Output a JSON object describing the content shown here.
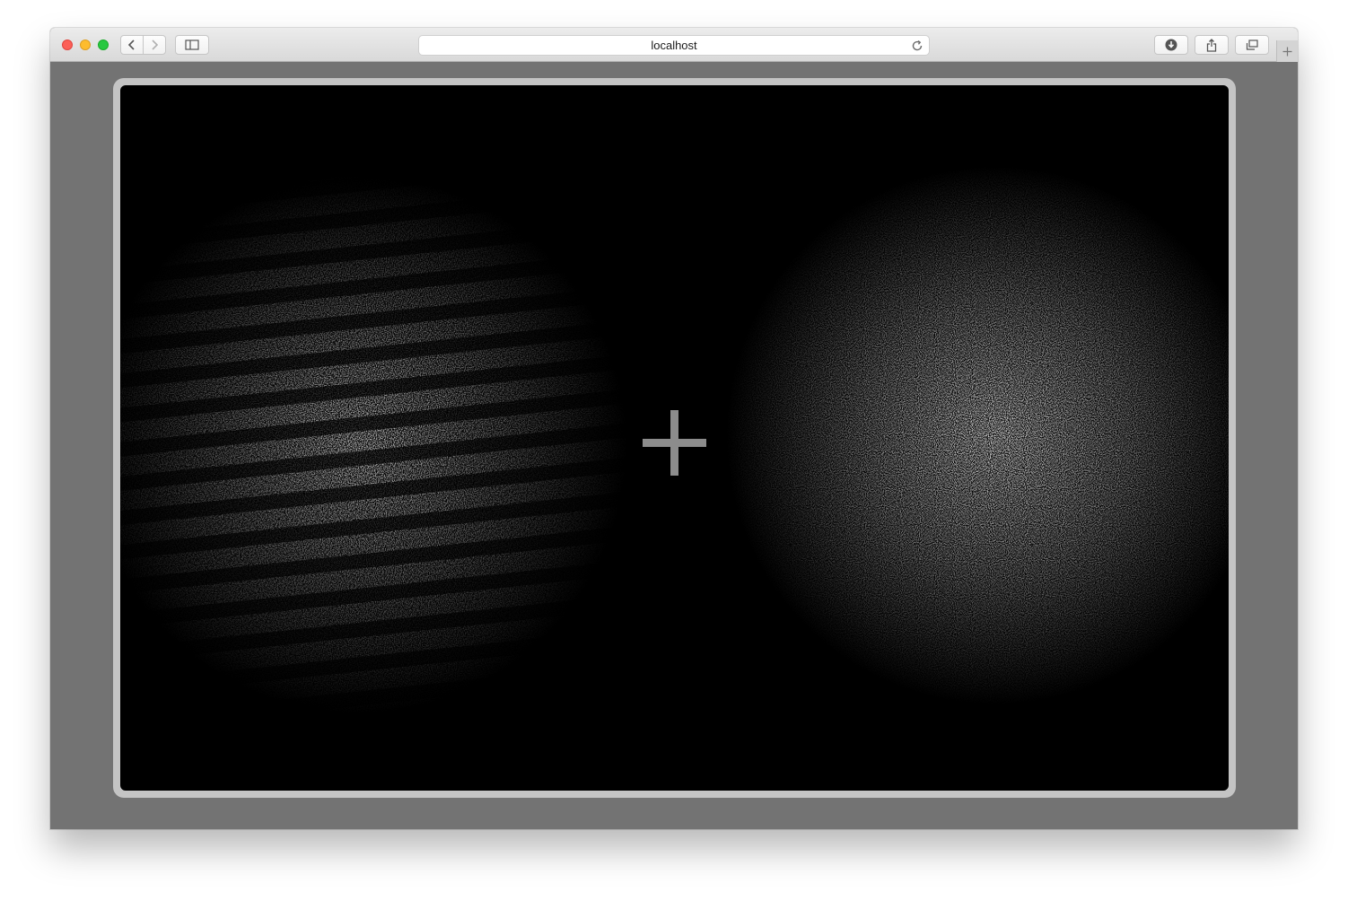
{
  "browser": {
    "url": "localhost",
    "icons": {
      "back": "chevron-left-icon",
      "forward": "chevron-right-icon",
      "sidebar": "sidebar-icon",
      "reload": "reload-icon",
      "download": "download-icon",
      "share": "share-icon",
      "tabs": "tabs-icon",
      "new_tab": "plus-icon"
    }
  },
  "stimulus": {
    "background_color": "#000000",
    "frame_color": "#c4c4c4",
    "page_background": "#737373",
    "fixation_color": "#8c8c8c",
    "left_patch": "grating-in-noise",
    "right_patch": "noise-only"
  }
}
